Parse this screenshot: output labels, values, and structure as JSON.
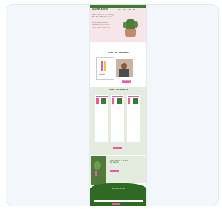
{
  "header": {
    "logo": "ALOHA KAPO",
    "nav": [
      "SHOP",
      "ABOUT",
      "FAQ",
      "CART"
    ]
  },
  "hero": {
    "headline": "Ohia Lehua Seedlings for the Plant Lover",
    "subtext": "Rare native plants shipped to your door",
    "links": [
      "Shop Now",
      "Learn More"
    ]
  },
  "about": {
    "heading": "MEET THE GROWERS",
    "card_text": "Hand grown on the Big Island",
    "button": "Learn More"
  },
  "products": {
    "heading": "SHOP THE PLANTS",
    "items": [
      {
        "name": "Ohia Lehua",
        "price": "$45"
      },
      {
        "name": "Koa Seedling",
        "price": "$35"
      },
      {
        "name": "Maile Vine",
        "price": "$40"
      }
    ],
    "button": "Shop All"
  },
  "promo": {
    "headline": "Give the Gift of Aloha this Season",
    "button": "Gift Cards"
  },
  "footer": {
    "brand": "NaturePalms",
    "email_placeholder": "Email address",
    "submit": "Sign Up"
  },
  "colors": {
    "brand_green": "#3d7a2e",
    "accent_pink": "#e85aa6",
    "hero_pink": "#f6e6ea",
    "sage": "#e4ece0"
  }
}
